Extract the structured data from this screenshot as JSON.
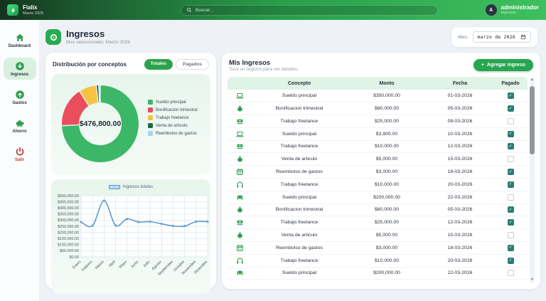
{
  "topbar": {
    "app_name": "Fialix",
    "period": "Marzo 2026",
    "search_placeholder": "Buscar...",
    "user_name": "administrador",
    "user_role": "Ingresos",
    "avatar_initial": "A"
  },
  "sidebar": {
    "items": [
      {
        "label": "Dashboard",
        "icon": "home-icon",
        "active": false
      },
      {
        "label": "Ingresos",
        "icon": "ingresos-icon",
        "active": true
      },
      {
        "label": "Gastos",
        "icon": "gastos-icon",
        "active": false
      },
      {
        "label": "Ahorro",
        "icon": "ahorro-icon",
        "active": false
      },
      {
        "label": "Salir",
        "icon": "salir-icon",
        "active": false,
        "danger": true
      }
    ]
  },
  "page": {
    "title": "Ingresos",
    "subtitle": "Mes seleccionado: Marzo 2026",
    "month_label": "Mes:",
    "month_value": "marzo de 2026"
  },
  "distribution": {
    "title": "Distribución por conceptos",
    "toggles": [
      {
        "label": "Totales",
        "active": true
      },
      {
        "label": "Pagados",
        "active": false
      }
    ]
  },
  "incomes": {
    "title": "Mis Ingresos",
    "subtitle": "Toca un registro para ver detalles.",
    "add_button_label": "Agregar ingreso",
    "columns": [
      "Concepto",
      "Monto",
      "Fecha",
      "Pagado"
    ],
    "rows": [
      {
        "icon": "laptop-icon",
        "concepto": "Sueldo principal",
        "monto": "$350,000.00",
        "fecha": "01-03-2026",
        "pagado": true
      },
      {
        "icon": "moneybag-icon",
        "concepto": "Bonificacion trimestral",
        "monto": "$80,000.00",
        "fecha": "05-03-2026",
        "pagado": true
      },
      {
        "icon": "handshake-icon",
        "concepto": "Trabajo freelance",
        "monto": "$25,000.00",
        "fecha": "08-03-2026",
        "pagado": false
      },
      {
        "icon": "laptop-icon",
        "concepto": "Sueldo principal",
        "monto": "$3,800.00",
        "fecha": "10-03-2026",
        "pagado": true
      },
      {
        "icon": "handshake-icon",
        "concepto": "Trabajo freelance",
        "monto": "$10,000.00",
        "fecha": "12-03-2026",
        "pagado": true
      },
      {
        "icon": "moneybag-icon",
        "concepto": "Venta de articulo",
        "monto": "$5,000.00",
        "fecha": "15-03-2026",
        "pagado": false
      },
      {
        "icon": "calendar-icon",
        "concepto": "Reembolso de gastos",
        "monto": "$3,000.00",
        "fecha": "18-03-2026",
        "pagado": true
      },
      {
        "icon": "headset-icon",
        "concepto": "Trabajo freelance",
        "monto": "$10,000.00",
        "fecha": "20-03-2026",
        "pagado": true
      },
      {
        "icon": "car-icon",
        "concepto": "Sueldo principal",
        "monto": "$200,000.00",
        "fecha": "22-03-2026",
        "pagado": false
      },
      {
        "icon": "moneybag-icon",
        "concepto": "Bonificacion trimestral",
        "monto": "$80,000.00",
        "fecha": "05-03-2026",
        "pagado": true
      },
      {
        "icon": "handshake-icon",
        "concepto": "Trabajo freelance",
        "monto": "$25,000.00",
        "fecha": "12-03-2026",
        "pagado": true
      },
      {
        "icon": "moneybag-icon",
        "concepto": "Venta de articulo",
        "monto": "$5,000.00",
        "fecha": "15-03-2026",
        "pagado": false
      },
      {
        "icon": "calendar-icon",
        "concepto": "Reembolso de gastos",
        "monto": "$3,000.00",
        "fecha": "18-03-2026",
        "pagado": true
      },
      {
        "icon": "headset-icon",
        "concepto": "Trabajo freelance",
        "monto": "$10,000.00",
        "fecha": "20-03-2026",
        "pagado": true
      },
      {
        "icon": "car-icon",
        "concepto": "Sueldo principal",
        "monto": "$200,000.00",
        "fecha": "22-03-2026",
        "pagado": false
      }
    ]
  },
  "chart_data": [
    {
      "type": "pie",
      "title": "Distribución por conceptos",
      "center_label": "$476,800.00",
      "labels": [
        "Sueldo principal",
        "Bonificacion trimestral",
        "Trabajo freelance",
        "Venta de articulo",
        "Reembolso de gastos"
      ],
      "values": [
        353800,
        80000,
        35000,
        5000,
        3000
      ],
      "colors": [
        "#3cb767",
        "#ea4d5c",
        "#f5c242",
        "#1d6b3d",
        "#a9d2ef"
      ],
      "legend_position": "right",
      "donut": true
    },
    {
      "type": "line",
      "legend": "Ingresos totales",
      "x": [
        "Enero",
        "Febrero",
        "Marzo",
        "Abril",
        "Mayo",
        "Junio",
        "Julio",
        "Agosto",
        "Septiembre",
        "Octubre",
        "Noviembre",
        "Diciembre"
      ],
      "values": [
        285000,
        255000,
        460000,
        257000,
        310000,
        285000,
        288000,
        270000,
        253000,
        251000,
        288000,
        288000
      ],
      "ylim": [
        0,
        500000
      ],
      "ytick_step": 50000,
      "ytick_labels": [
        "$0.00",
        "$50,000.00",
        "$100,000.00",
        "$150,000.00",
        "$200,000.00",
        "$250,000.00",
        "$300,000.00",
        "$350,000.00",
        "$400,000.00",
        "$450,000.00",
        "$500,000.00"
      ],
      "line_color": "#5b9bd5",
      "fill_color": "#b9d9f2",
      "grid": true,
      "legend_position": "top"
    }
  ],
  "brand_colors": {
    "accent_green": "#28a551",
    "danger_red": "#c23a2b",
    "checkbox_teal": "#2a7d72"
  }
}
